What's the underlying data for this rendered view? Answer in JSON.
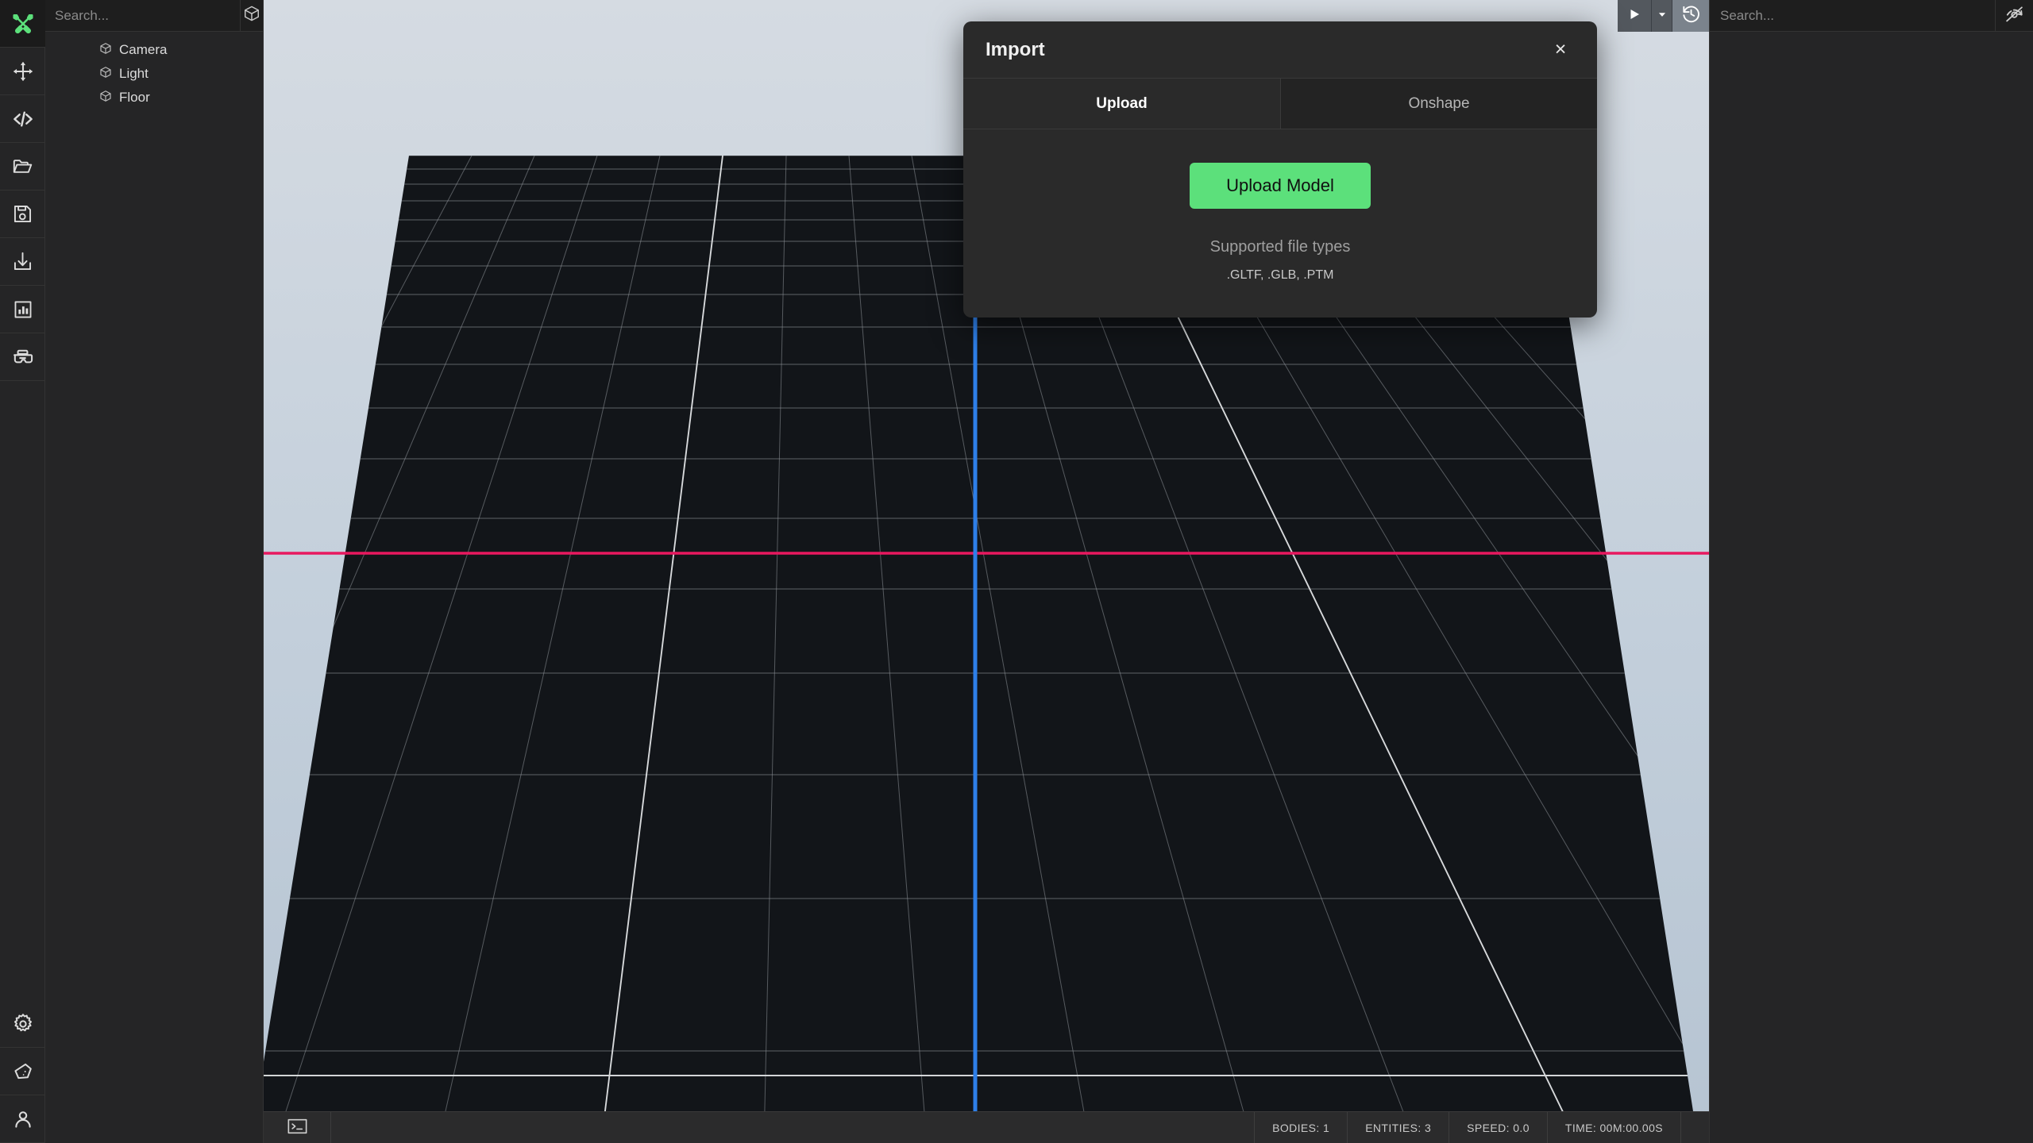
{
  "app": {
    "accent_green": "#5ce07b",
    "panel_bg": "#252526",
    "axis_x_color": "#e8185f",
    "axis_z_color": "#2e7fe8"
  },
  "toolbar": {
    "items": [
      {
        "name": "tools-icon",
        "label": "Tools",
        "active": true
      },
      {
        "name": "move-icon",
        "label": "Move",
        "active": false
      },
      {
        "name": "code-icon",
        "label": "Code",
        "active": false
      },
      {
        "name": "folder-icon",
        "label": "Open",
        "active": false
      },
      {
        "name": "save-icon",
        "label": "Save",
        "active": false
      },
      {
        "name": "import-icon",
        "label": "Import",
        "active": false
      },
      {
        "name": "chart-icon",
        "label": "Analytics",
        "active": false
      },
      {
        "name": "vr-icon",
        "label": "VR",
        "active": false
      }
    ],
    "bottom_items": [
      {
        "name": "gear-icon",
        "label": "Settings"
      },
      {
        "name": "polygon-icon",
        "label": "Shapes"
      },
      {
        "name": "user-icon",
        "label": "Account"
      }
    ]
  },
  "hierarchy": {
    "search_placeholder": "Search...",
    "search_value": "",
    "add_button_icon": "cube-icon",
    "items": [
      {
        "label": "Camera",
        "icon": "cube-icon"
      },
      {
        "label": "Light",
        "icon": "cube-icon"
      },
      {
        "label": "Floor",
        "icon": "cube-icon"
      }
    ]
  },
  "viewport": {
    "playback": {
      "play_icon": "play-icon",
      "dropdown_icon": "chevron-down-icon",
      "reset_icon": "history-reset-icon"
    }
  },
  "statusbar": {
    "terminal_icon": "terminal-icon",
    "cells": [
      {
        "label": "BODIES: 1"
      },
      {
        "label": "ENTITIES: 3"
      },
      {
        "label": "SPEED: 0.0"
      },
      {
        "label": "TIME: 00M:00.00S"
      }
    ]
  },
  "inspector": {
    "search_placeholder": "Search...",
    "search_value": "",
    "visibility_icon": "eye-off-icon"
  },
  "import_dialog": {
    "title": "Import",
    "close_label": "×",
    "tabs": [
      {
        "label": "Upload",
        "active": true
      },
      {
        "label": "Onshape",
        "active": false
      }
    ],
    "upload_button_label": "Upload Model",
    "supported_label": "Supported file types",
    "supported_types": ".GLTF, .GLB, .PTM"
  }
}
